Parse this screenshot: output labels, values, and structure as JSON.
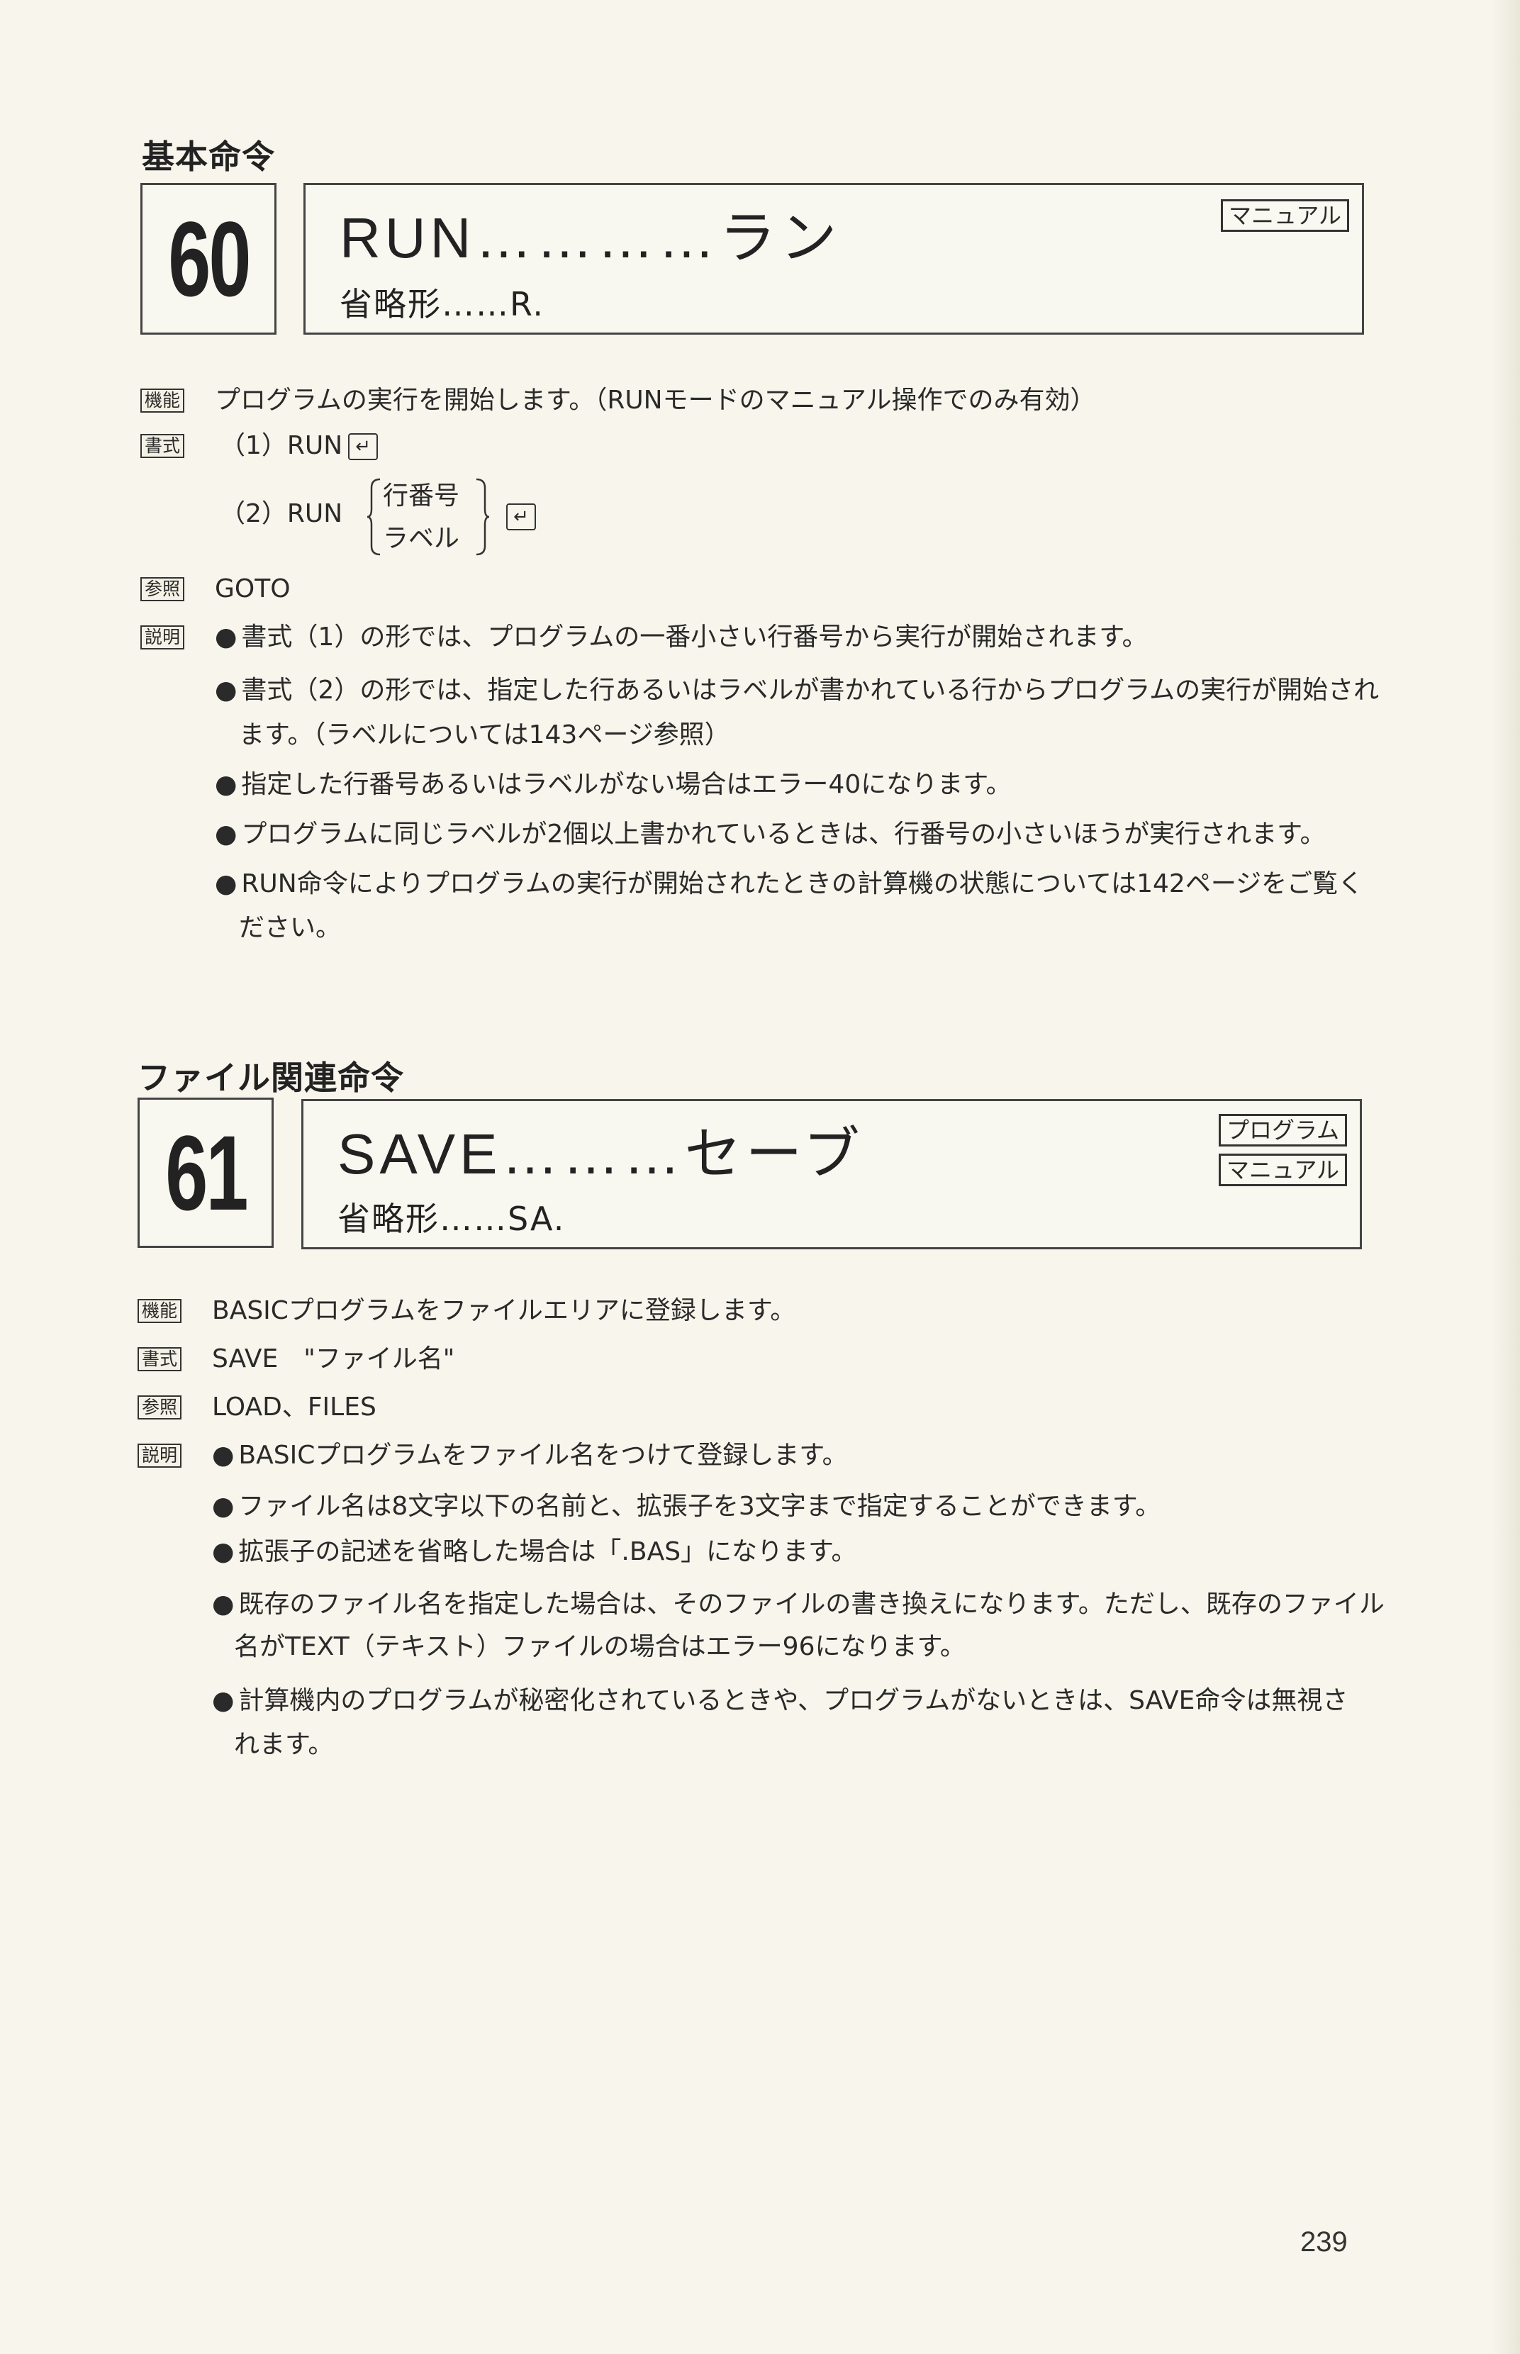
{
  "sections": [
    {
      "category": "基本命令",
      "number": "60",
      "command": "RUN…………ラン",
      "abbreviation": "省略形……R.",
      "tags": [
        "マニュアル"
      ],
      "function_label": "機能",
      "function_text": "プログラムの実行を開始します。（RUNモードのマニュアル操作でのみ有効）",
      "syntax_label": "書式",
      "syntax_1": "（1）RUN",
      "syntax_2_prefix": "（2）RUN",
      "syntax_2_options": [
        "行番号",
        "ラベル"
      ],
      "ref_label": "参照",
      "ref_text": "GOTO",
      "desc_label": "説明",
      "desc": [
        "書式（1）の形では、プログラムの一番小さい行番号から実行が開始されます。",
        "書式（2）の形では、指定した行あるいはラベルが書かれている行からプログラムの実行が開始され",
        "ます。（ラベルについては143ページ参照）",
        "指定した行番号あるいはラベルがない場合はエラー40になります。",
        "プログラムに同じラベルが2個以上書かれているときは、行番号の小さいほうが実行されます。",
        "RUN命令によりプログラムの実行が開始されたときの計算機の状態については142ページをご覧く",
        "ださい。"
      ]
    },
    {
      "category": "ファイル関連命令",
      "number": "61",
      "command": "SAVE………セーブ",
      "abbreviation": "省略形……SA.",
      "tags": [
        "プログラム",
        "マニュアル"
      ],
      "function_label": "機能",
      "function_text": "BASICプログラムをファイルエリアに登録します。",
      "syntax_label": "書式",
      "syntax_text": "SAVE　\"ファイル名\"",
      "ref_label": "参照",
      "ref_text": "LOAD、FILES",
      "desc_label": "説明",
      "desc": [
        "BASICプログラムをファイル名をつけて登録します。",
        "ファイル名は8文字以下の名前と、拡張子を3文字まで指定することができます。",
        "拡張子の記述を省略した場合は「.BAS」になります。",
        "既存のファイル名を指定した場合は、そのファイルの書き換えになります。ただし、既存のファイル",
        "名がTEXT（テキスト）ファイルの場合はエラー96になります。",
        "計算機内のプログラムが秘密化されているときや、プログラムがないときは、SAVE命令は無視さ",
        "れます。"
      ]
    }
  ],
  "enter_key": "↵",
  "page_number": "239"
}
